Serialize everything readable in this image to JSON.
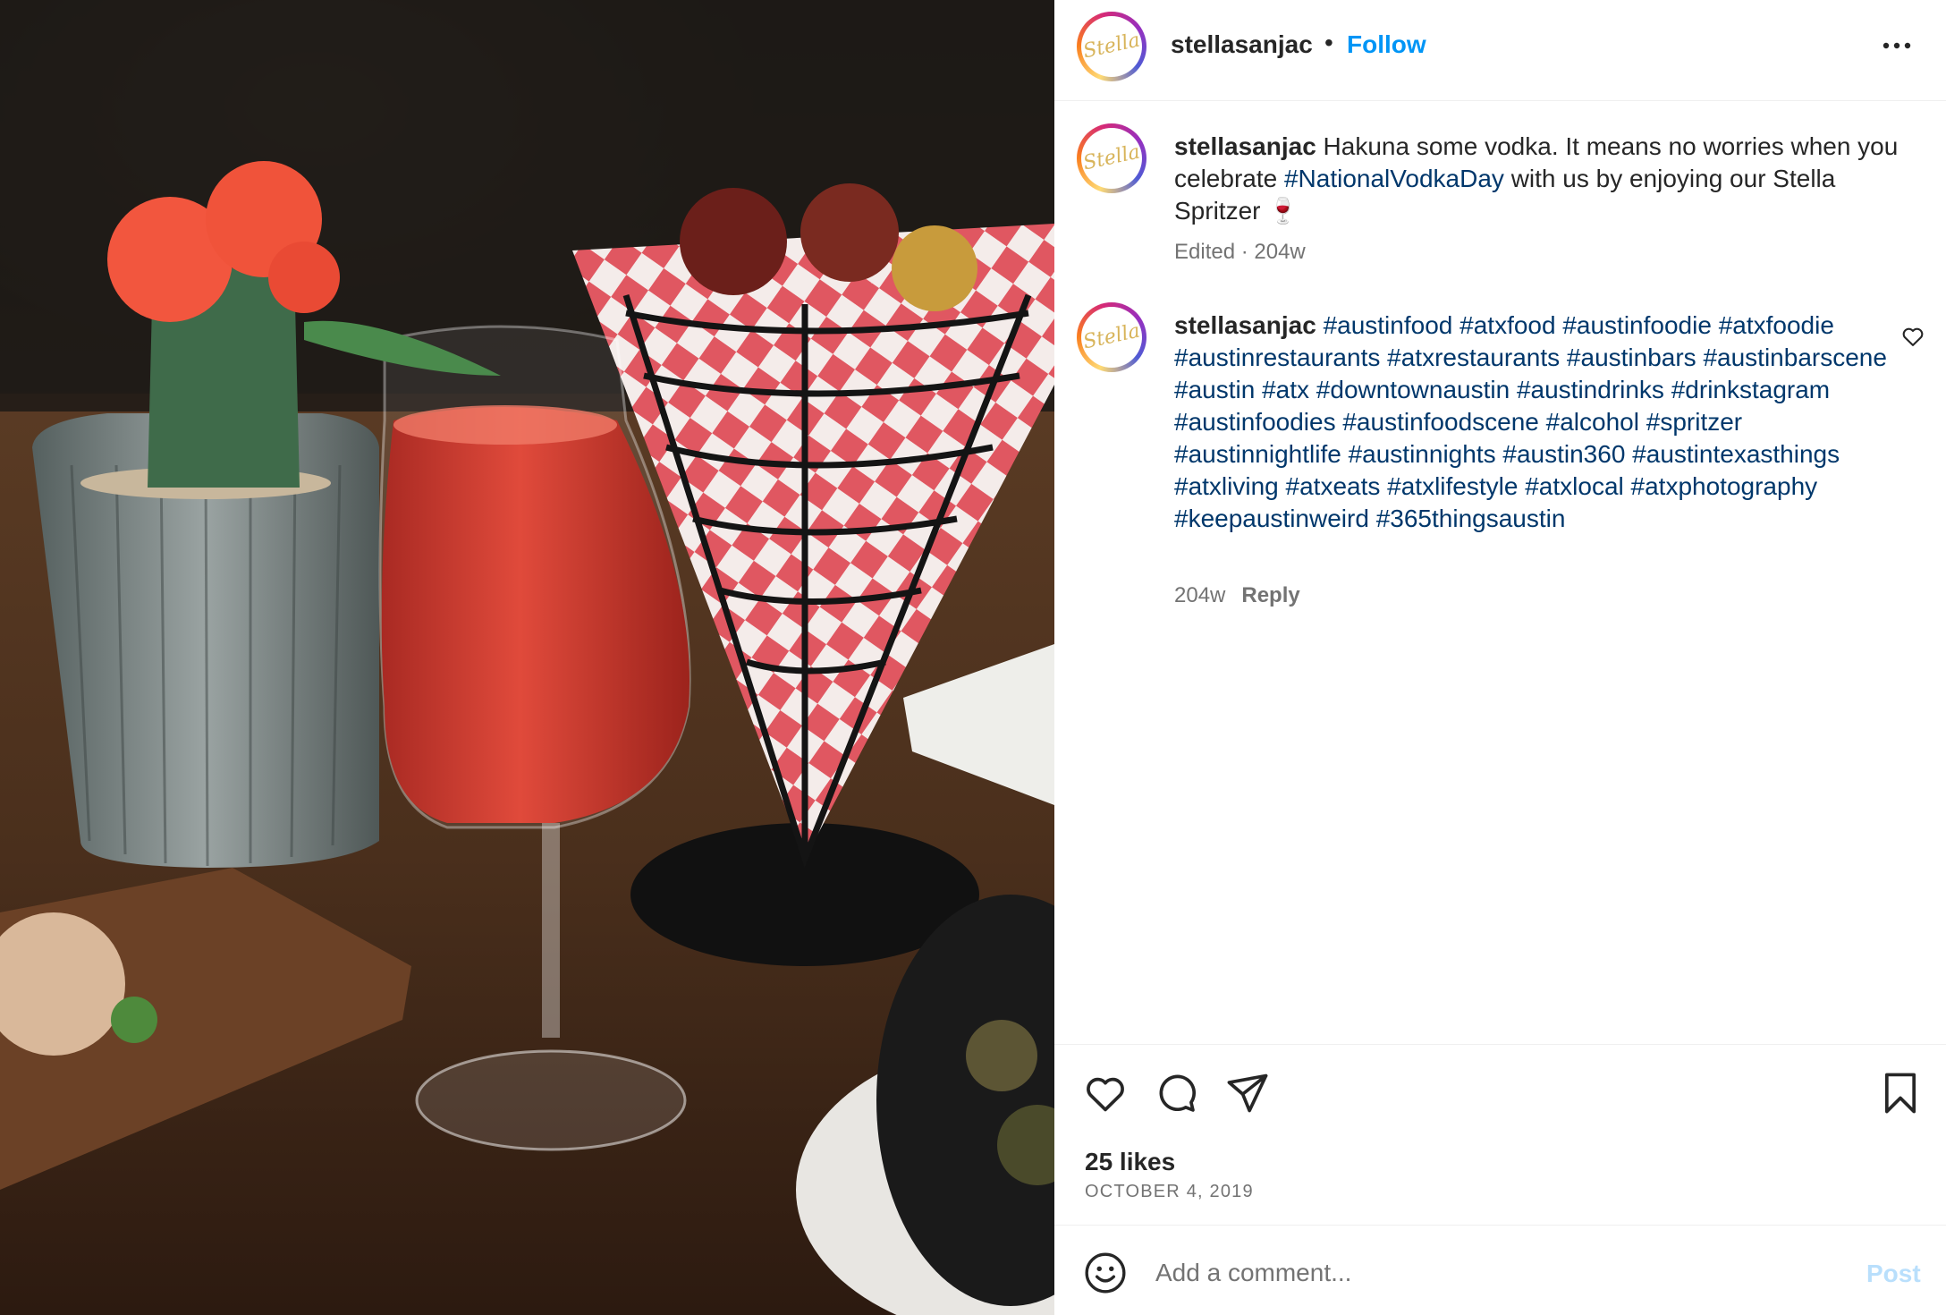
{
  "post": {
    "username": "stellasanjac",
    "follow_label": "Follow",
    "separator": "•",
    "avatar_logo_text": "Stella",
    "more_icon": "more-horizontal-icon"
  },
  "caption": {
    "username": "stellasanjac",
    "text_before": " Hakuna some vodka. It means no worries when you celebrate ",
    "hashtag": "#NationalVodkaDay",
    "text_after": " with us by enjoying our Stella Spritzer ",
    "emoji": "🍷",
    "meta": "Edited · 204w"
  },
  "comment": {
    "username": "stellasanjac",
    "hashtags": [
      "#austinfood",
      "#atxfood",
      "#austinfoodie",
      "#atxfoodie",
      "#austinrestaurants",
      "#atxrestaurants",
      "#austinbars",
      "#austinbarscene",
      "#austin",
      "#atx",
      "#downtownaustin",
      "#austindrinks",
      "#drinkstagram",
      "#austinfoodies",
      "#austinfoodscene",
      "#alcohol",
      "#spritzer",
      "#austinnightlife",
      "#austinnights",
      "#austin360",
      "#austintexasthings",
      "#atxliving",
      "#atxeats",
      "#atxlifestyle",
      "#atxlocal",
      "#atxphotography",
      "#keepaustinweird",
      "#365thingsaustin"
    ],
    "time": "204w",
    "reply_label": "Reply"
  },
  "actions": {
    "icons": [
      "heart-icon",
      "comment-icon",
      "share-icon",
      "bookmark-icon"
    ]
  },
  "likes": "25 likes",
  "date": "OCTOBER 4, 2019",
  "add_comment": {
    "placeholder": "Add a comment...",
    "post_label": "Post"
  },
  "colors": {
    "link_blue": "#0095f6",
    "hashtag_navy": "#00376b",
    "muted_gray": "#737373",
    "post_disabled": "#b9dffc"
  }
}
